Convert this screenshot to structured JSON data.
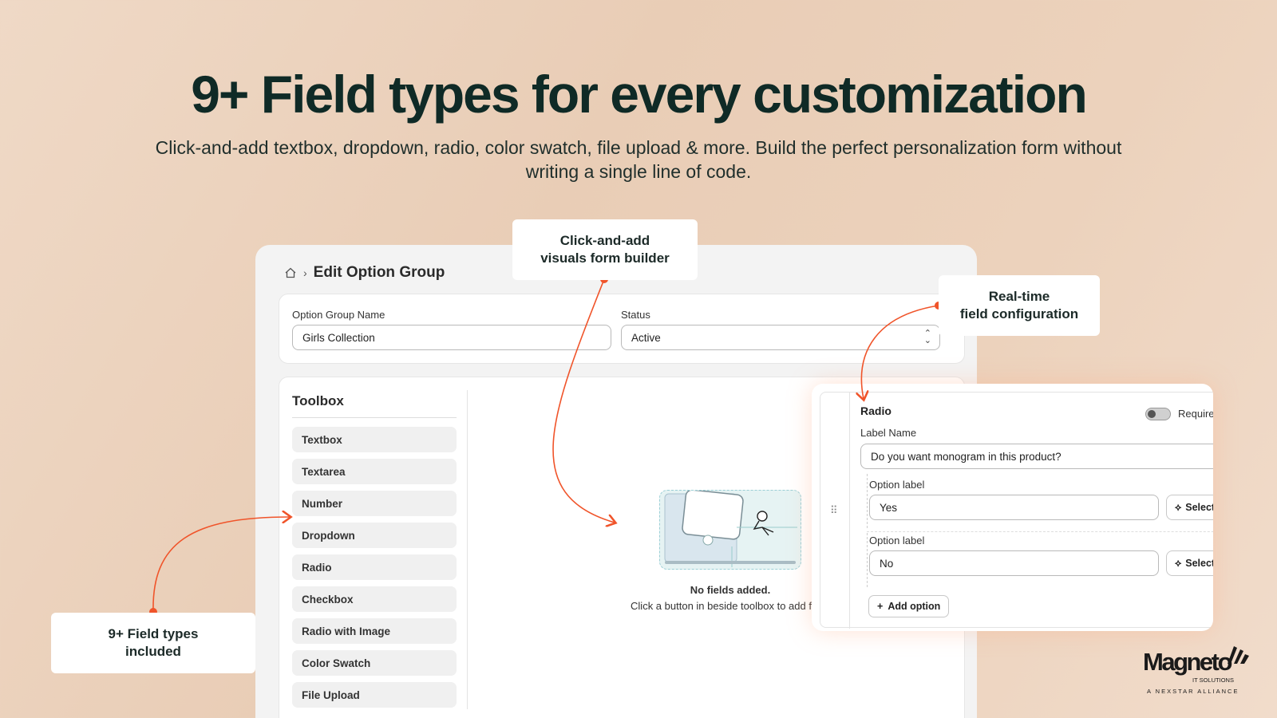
{
  "hero": {
    "title": "9+ Field types for every customization",
    "subtitle": "Click-and-add textbox, dropdown, radio, color swatch, file upload & more. Build the perfect personalization form without writing a single line of code."
  },
  "editor": {
    "breadcrumb_title": "Edit Option Group",
    "group_name_label": "Option Group Name",
    "group_name_value": "Girls Collection",
    "status_label": "Status",
    "status_value": "Active",
    "toolbox_title": "Toolbox",
    "tools": [
      "Textbox",
      "Textarea",
      "Number",
      "Dropdown",
      "Radio",
      "Checkbox",
      "Radio with Image",
      "Color Swatch",
      "File Upload"
    ],
    "empty_title": "No fields added.",
    "empty_subtitle": "Click a button in beside toolbox to add fiel"
  },
  "radio_panel": {
    "title": "Radio",
    "required_label": "Required",
    "required_on": false,
    "label_name_label": "Label Name",
    "label_name_value": "Do you want monogram in this product?",
    "options": [
      {
        "label": "Option label",
        "value": "Yes",
        "button": "Select P"
      },
      {
        "label": "Option label",
        "value": "No",
        "button": "Select P"
      }
    ],
    "add_option_label": "Add option"
  },
  "callouts": {
    "form_builder_line1": "Click-and-add",
    "form_builder_line2": "visuals form builder",
    "realtime_line1": "Real-time",
    "realtime_line2": "field configuration",
    "field_types_line1": "9+ Field types",
    "field_types_line2": "included"
  },
  "logo": {
    "wordmark": "Magneto",
    "sub": "IT SOLUTIONS",
    "tagline": "A NEXSTAR ALLIANCE"
  },
  "colors": {
    "accent": "#f0542a",
    "heading": "#0f2a26",
    "background": "#ecd2bc"
  }
}
